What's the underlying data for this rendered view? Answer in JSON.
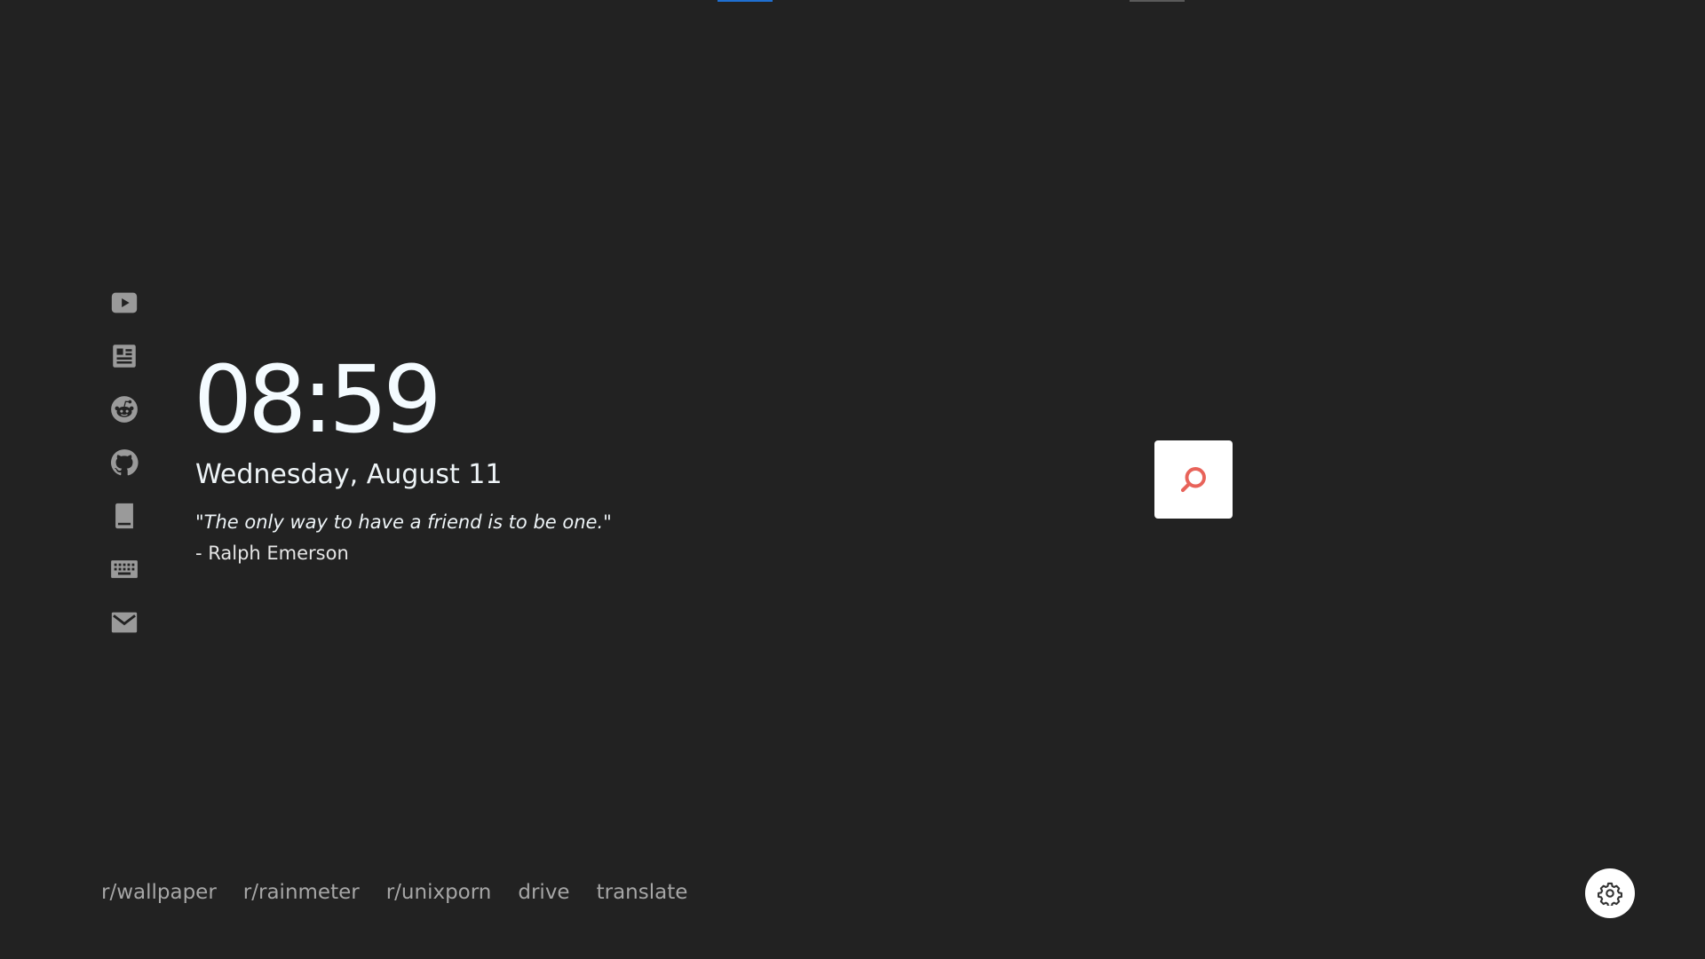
{
  "colors": {
    "background": "#222222",
    "sidebar_icon": "#9a9a9a",
    "text_primary": "#f4fbff",
    "link_text": "#a6a6a6",
    "search_icon": "#e8635a",
    "accent_blue": "#1f6fd1"
  },
  "sidebar": {
    "items": [
      {
        "icon": "youtube-icon"
      },
      {
        "icon": "news-icon"
      },
      {
        "icon": "reddit-icon"
      },
      {
        "icon": "github-icon"
      },
      {
        "icon": "book-icon"
      },
      {
        "icon": "keyboard-icon"
      },
      {
        "icon": "mail-icon"
      }
    ]
  },
  "main": {
    "time": "08:59",
    "date": "Wednesday, August 11",
    "quote": "\"The only way to have a friend is to be one.\"",
    "author": "- Ralph Emerson"
  },
  "search": {
    "icon": "search-icon"
  },
  "links": [
    {
      "label": "r/wallpaper"
    },
    {
      "label": "r/rainmeter"
    },
    {
      "label": "r/unixporn"
    },
    {
      "label": "drive"
    },
    {
      "label": "translate"
    }
  ],
  "settings": {
    "icon": "gear-icon"
  }
}
